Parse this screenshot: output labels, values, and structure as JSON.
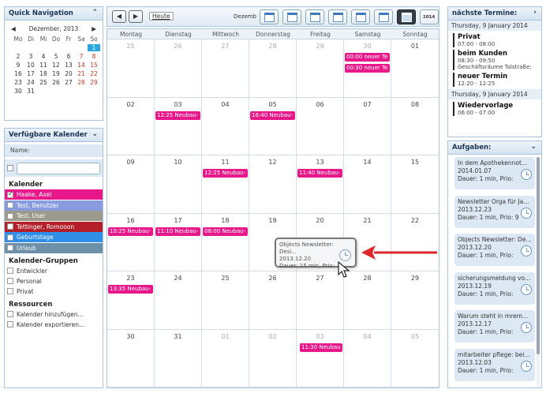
{
  "quick_nav": {
    "title": "Quick Navigation",
    "month_label": "Dezember, 2013",
    "prev": "◀",
    "next": "▶",
    "weekdays": [
      "Mo",
      "Di",
      "Mi",
      "Do",
      "Fr",
      "Sa",
      "So"
    ],
    "weeks": [
      [
        "",
        "",
        "",
        "",
        "",
        "",
        "1"
      ],
      [
        "2",
        "3",
        "4",
        "5",
        "6",
        "7",
        "8"
      ],
      [
        "9",
        "10",
        "11",
        "12",
        "13",
        "14",
        "15"
      ],
      [
        "16",
        "17",
        "18",
        "19",
        "20",
        "21",
        "22"
      ],
      [
        "23",
        "24",
        "25",
        "26",
        "27",
        "28",
        "29"
      ],
      [
        "30",
        "31",
        "",
        "",
        "",
        "",
        ""
      ]
    ],
    "today": "1"
  },
  "calendars_panel": {
    "title": "Verfügbare Kalender",
    "name_label": "Name:",
    "sections": {
      "kalender": "Kalender",
      "gruppen": "Kalender-Gruppen",
      "ressourcen": "Ressourcen"
    },
    "calendars": [
      {
        "label": "Haake, Axel",
        "color": "#e8188a",
        "checked": true
      },
      {
        "label": "Test, Benutzer",
        "color": "#8a9ce0",
        "checked": false
      },
      {
        "label": "Test, User",
        "color": "#9b9a8c",
        "checked": false
      },
      {
        "label": "Tettinger, Romooon",
        "color": "#b3202a",
        "checked": false
      },
      {
        "label": "Geburtstage",
        "color": "#2f8fe8",
        "checked": false
      },
      {
        "label": "Urlaub",
        "color": "#6d8fa8",
        "checked": false
      }
    ],
    "groups": [
      "Entwickler",
      "Personal",
      "Privat"
    ],
    "actions": [
      "Kalender hinzufügen...",
      "Kalender exportieren..."
    ]
  },
  "toolbar": {
    "prev": "◀",
    "next": "▶",
    "today_label": "Heute",
    "month_label": "Dezemb",
    "year_badge": "2014"
  },
  "month_view": {
    "weekdays": [
      "Montag",
      "Dienstag",
      "Mittwoch",
      "Donnerstag",
      "Freitag",
      "Samstag",
      "Sonntag"
    ],
    "days": [
      {
        "n": "25",
        "other": true
      },
      {
        "n": "26",
        "other": true
      },
      {
        "n": "27",
        "other": true
      },
      {
        "n": "28",
        "other": true
      },
      {
        "n": "29",
        "other": true
      },
      {
        "n": "30",
        "other": true
      },
      {
        "n": "01",
        "other": false
      },
      {
        "n": "02"
      },
      {
        "n": "03"
      },
      {
        "n": "04"
      },
      {
        "n": "05"
      },
      {
        "n": "06"
      },
      {
        "n": "07"
      },
      {
        "n": "08"
      },
      {
        "n": "09"
      },
      {
        "n": "10"
      },
      {
        "n": "11"
      },
      {
        "n": "12"
      },
      {
        "n": "13"
      },
      {
        "n": "14"
      },
      {
        "n": "15"
      },
      {
        "n": "16"
      },
      {
        "n": "17"
      },
      {
        "n": "18"
      },
      {
        "n": "19"
      },
      {
        "n": "20"
      },
      {
        "n": "21"
      },
      {
        "n": "22"
      },
      {
        "n": "23"
      },
      {
        "n": "24"
      },
      {
        "n": "25"
      },
      {
        "n": "26"
      },
      {
        "n": "27"
      },
      {
        "n": "28"
      },
      {
        "n": "29"
      },
      {
        "n": "30"
      },
      {
        "n": "31"
      },
      {
        "n": "01",
        "other": true
      },
      {
        "n": "02",
        "other": true
      },
      {
        "n": "03",
        "other": true
      },
      {
        "n": "04",
        "other": true
      },
      {
        "n": "05",
        "other": true
      }
    ],
    "events": [
      {
        "day": 5,
        "slot": 0,
        "text": "00:00 neuer Te"
      },
      {
        "day": 5,
        "slot": 1,
        "text": "00:30 neuer Te"
      },
      {
        "day": 8,
        "slot": 0,
        "text": "12:25 Neubau-"
      },
      {
        "day": 10,
        "slot": 0,
        "text": "16:40 Neubau-"
      },
      {
        "day": 16,
        "slot": 0,
        "text": "12:25 Neubau-"
      },
      {
        "day": 18,
        "slot": 0,
        "text": "11:40 Neubau-"
      },
      {
        "day": 21,
        "slot": 0,
        "text": "10:25 Neubau-"
      },
      {
        "day": 22,
        "slot": 0,
        "text": "11:10 Neubau-"
      },
      {
        "day": 23,
        "slot": 0,
        "text": "08:00 Neubau-"
      },
      {
        "day": 28,
        "slot": 0,
        "text": "13:35 Neubau-"
      },
      {
        "day": 39,
        "slot": 0,
        "text": "11:30 Neubau"
      }
    ]
  },
  "tooltip": {
    "title": "Objects Newsletter: Desi...",
    "date": "2013.12.20",
    "duration": "Dauer: 15 min, Prio:"
  },
  "upcoming": {
    "title": "nächste Termine:",
    "groups": [
      {
        "date": "Thursday, 9 January 2014",
        "items": [
          {
            "title": "Privat",
            "time": "07:00 - 08:00",
            "extra": ""
          },
          {
            "title": "beim Kunden",
            "time": "08:30 - 09:50",
            "extra": "Geschäftsräume Talstraße;"
          },
          {
            "title": "neuer Termin",
            "time": "12:20 - 12:25",
            "extra": ""
          }
        ]
      },
      {
        "date": "Thursday, 9 January 2014",
        "items": [
          {
            "title": "Wiedervorlage",
            "time": "06:00 - 07:00",
            "extra": ""
          }
        ]
      }
    ]
  },
  "tasks": {
    "title": "Aufgaben:",
    "items": [
      {
        "title": "In dem Apothekennot...",
        "date": "2014.01.07",
        "meta": "Dauer: 1 min, Prio:"
      },
      {
        "title": "Newsletter Orga für Ja...",
        "date": "2013.12.23",
        "meta": "Dauer: 1 min, Prio: 9"
      },
      {
        "title": "Objects Newsletter: De...",
        "date": "2013.12.20",
        "meta": "Dauer: 1 min, Prio:"
      },
      {
        "title": "sicherungsmeldung vo...",
        "date": "2013.12.19",
        "meta": "Dauer: 1 min, Prio:"
      },
      {
        "title": "Warum steht in mrem...",
        "date": "2013.12.17",
        "meta": "Dauer: 1 min, Prio:"
      },
      {
        "title": "mitarbeiter pflege: bei...",
        "date": "2013.12.03",
        "meta": "Dauer: 1 min, Prio:"
      }
    ]
  },
  "colors": {
    "event": "#e8188a",
    "accent": "#29a8e0",
    "arrow": "#e0262b"
  }
}
